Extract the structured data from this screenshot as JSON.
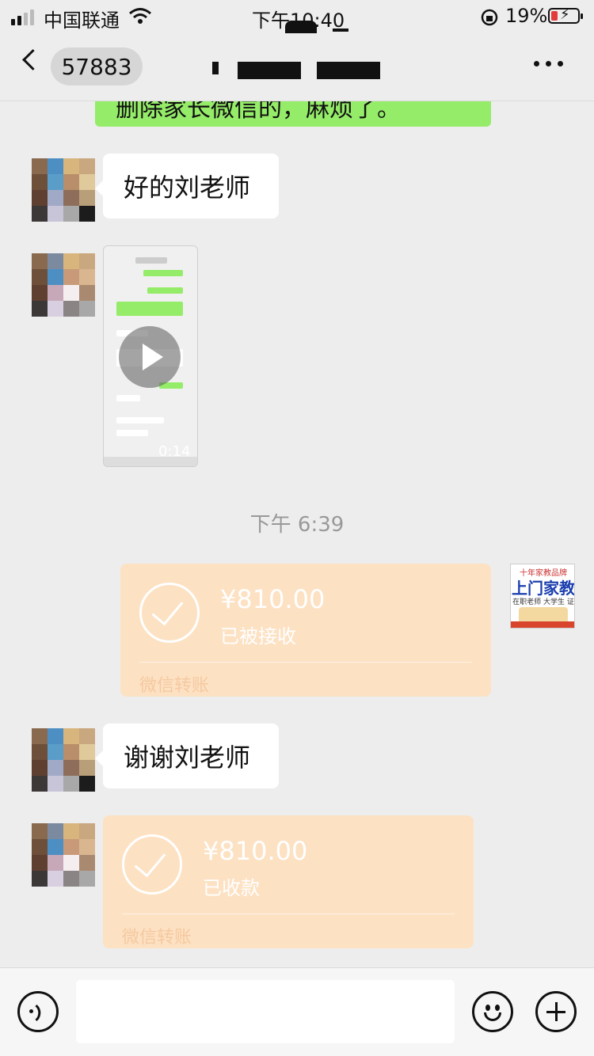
{
  "status_bar": {
    "carrier": "中国联通",
    "time": "下午10:40",
    "battery": "19%"
  },
  "nav": {
    "back_count": "57883",
    "more_icon": "more-dots-icon"
  },
  "messages": {
    "top_partial_text": "删除家长微信的，麻烦了。",
    "msg1": "好的刘老师",
    "video_duration": "0:14",
    "timestamp": "下午 6:39",
    "transfer_sent": {
      "amount": "¥810.00",
      "status": "已被接收",
      "label": "微信转账"
    },
    "logo_text": {
      "top": "十年家教品牌",
      "main": "上门家教",
      "sub": "在职老师 大学生 证件齐全"
    },
    "msg2": "谢谢刘老师",
    "transfer_received": {
      "amount": "¥810.00",
      "status": "已收款",
      "label": "微信转账"
    }
  },
  "colors": {
    "bubble_green": "#95ec69",
    "transfer_bg": "#fde1c3",
    "background": "#ededed"
  }
}
